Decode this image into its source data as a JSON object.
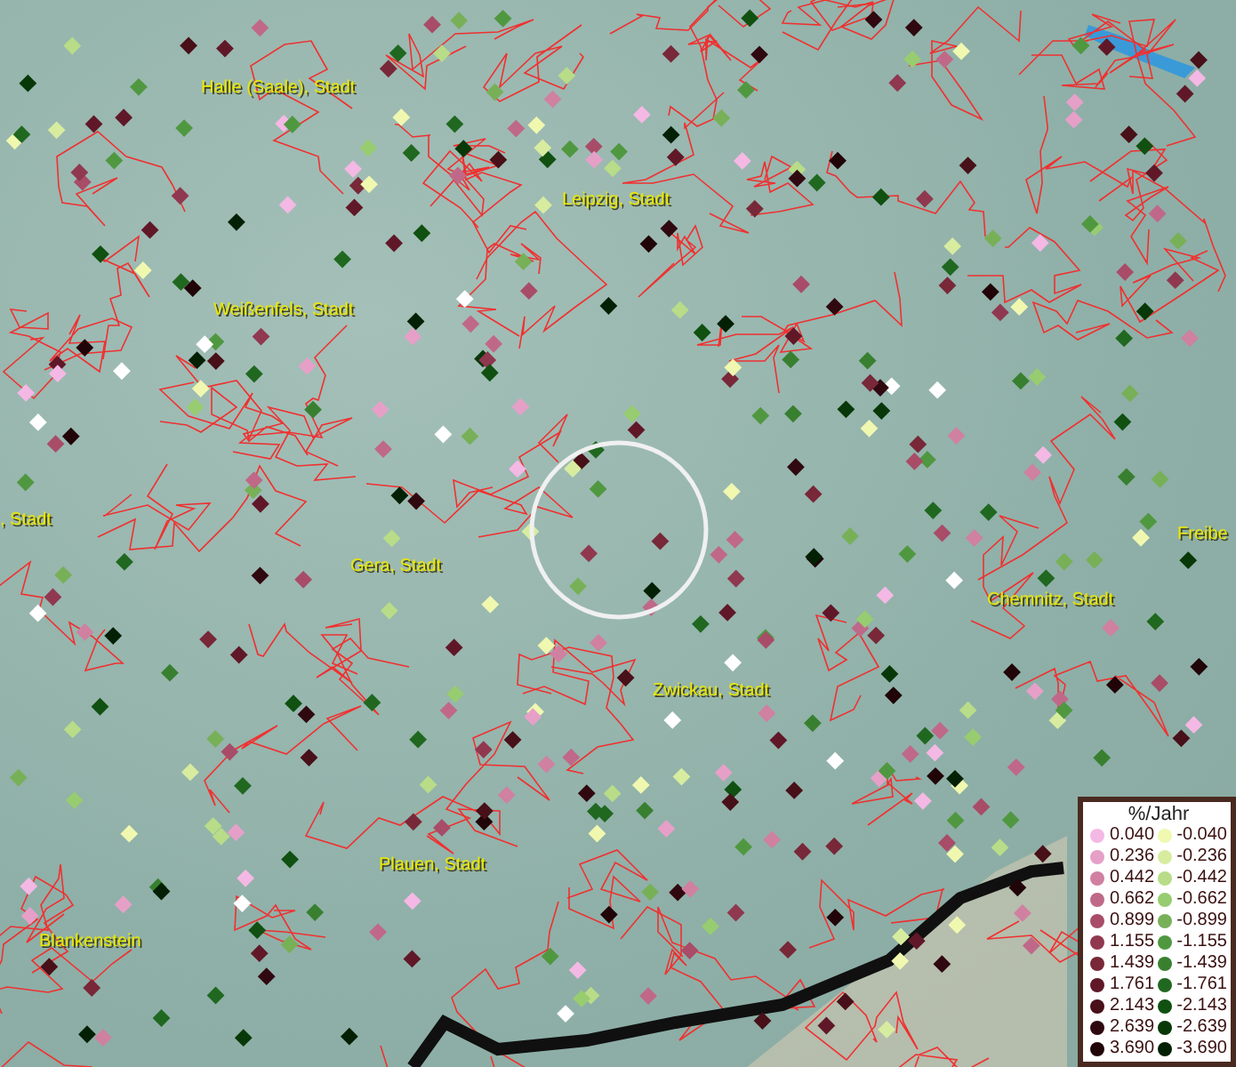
{
  "map": {
    "labels": [
      {
        "text": "Halle (Saale), Stadt"
      },
      {
        "text": "Leipzig, Stadt"
      },
      {
        "text": "Weißenfels, Stadt"
      },
      {
        "text": ", Stadt"
      },
      {
        "text": "Gera, Stadt"
      },
      {
        "text": "Chemnitz, Stadt"
      },
      {
        "text": "Freibe"
      },
      {
        "text": "Zwickau, Stadt"
      },
      {
        "text": "Plauen, Stadt"
      },
      {
        "text": "Blankenstein"
      }
    ]
  },
  "legend": {
    "title": "%/Jahr",
    "items": [
      {
        "value": "0.040",
        "color": "#f4b8e4"
      },
      {
        "value": "-0.040",
        "color": "#f0f8b0"
      },
      {
        "value": "0.236",
        "color": "#e6a0c8"
      },
      {
        "value": "-0.236",
        "color": "#d8eca0"
      },
      {
        "value": "0.442",
        "color": "#d080a0"
      },
      {
        "value": "-0.442",
        "color": "#b8dc88"
      },
      {
        "value": "0.662",
        "color": "#c06888"
      },
      {
        "value": "-0.662",
        "color": "#98cc70"
      },
      {
        "value": "0.899",
        "color": "#a84c68"
      },
      {
        "value": "-0.899",
        "color": "#78b058"
      },
      {
        "value": "1.155",
        "color": "#903850"
      },
      {
        "value": "-1.155",
        "color": "#509840"
      },
      {
        "value": "1.439",
        "color": "#782838"
      },
      {
        "value": "-1.439",
        "color": "#388030"
      },
      {
        "value": "1.761",
        "color": "#601828"
      },
      {
        "value": "-1.761",
        "color": "#206820"
      },
      {
        "value": "2.143",
        "color": "#481018"
      },
      {
        "value": "-2.143",
        "color": "#105010"
      },
      {
        "value": "2.639",
        "color": "#300810"
      },
      {
        "value": "-2.639",
        "color": "#083808"
      },
      {
        "value": "3.690",
        "color": "#200408"
      },
      {
        "value": "-3.690",
        "color": "#042004"
      }
    ]
  }
}
